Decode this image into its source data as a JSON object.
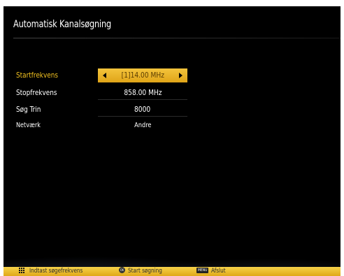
{
  "title": "Automatisk Kanalsøgning",
  "settings": [
    {
      "label": "Startfrekvens",
      "value": "[1]14.00 MHz",
      "selected": true
    },
    {
      "label": "Stopfrekvens",
      "value": "858.00 MHz",
      "selected": false
    },
    {
      "label": "Søg Trin",
      "value": "8000",
      "selected": false
    },
    {
      "label": "Netværk",
      "value": "Andre",
      "selected": false
    }
  ],
  "footer": {
    "numeric_hint": "Indtast søgefrekvens",
    "ok_key": "OK",
    "ok_hint": "Start søgning",
    "menu_key": "MENU",
    "menu_hint": "Afslut"
  },
  "colors": {
    "highlight": "#f0c020",
    "footer_bar": "#f6d24a",
    "background": "#000000"
  }
}
